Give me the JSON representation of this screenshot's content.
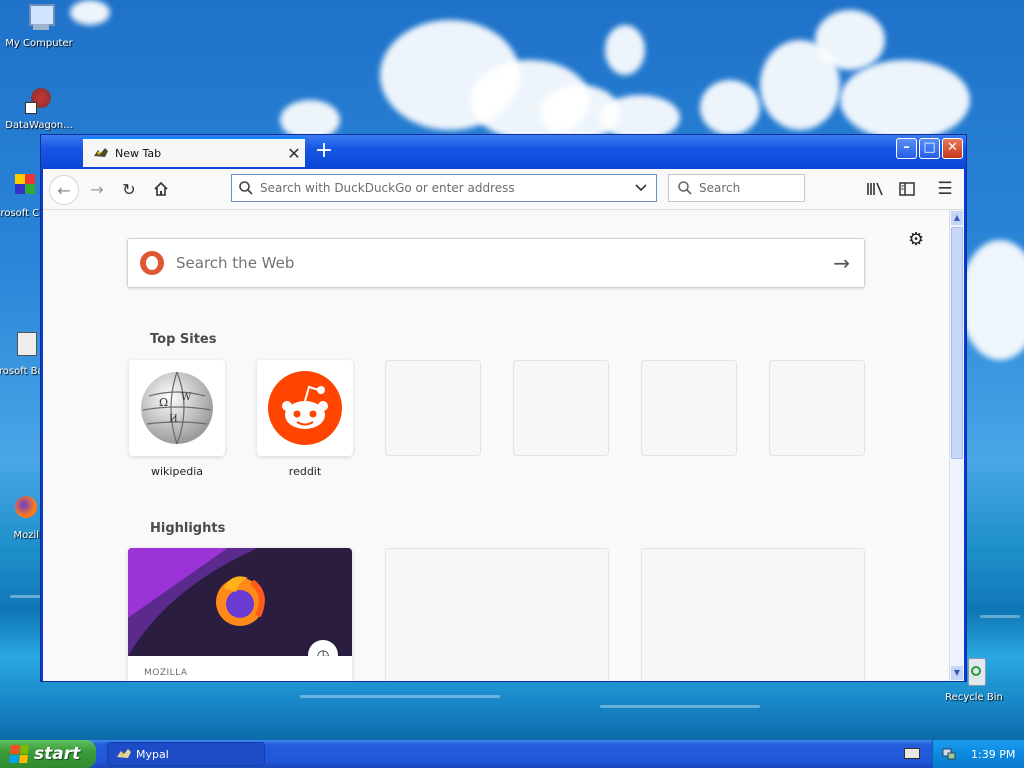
{
  "desktop": {
    "icons": [
      {
        "label": "My Computer"
      },
      {
        "label": "DataWagon..."
      },
      {
        "label": "Microsoft C++"
      },
      {
        "label": "Microsoft Basic"
      },
      {
        "label": "Mozilla"
      },
      {
        "label": "Recycle Bin"
      }
    ]
  },
  "browser": {
    "tab_title": "New Tab",
    "new_tab_glyph": "+",
    "window_buttons": {
      "minimize": "–",
      "maximize": "□",
      "close": "✕"
    },
    "toolbar": {
      "address_placeholder": "Search with DuckDuckGo or enter address",
      "search_placeholder": "Search"
    },
    "newtab": {
      "web_search_placeholder": "Search the Web",
      "top_sites_heading": "Top Sites",
      "top_sites": [
        {
          "label": "wikipedia",
          "icon": "wikipedia-globe-icon"
        },
        {
          "label": "reddit",
          "icon": "reddit-alien-icon"
        },
        {
          "label": ""
        },
        {
          "label": ""
        },
        {
          "label": ""
        },
        {
          "label": ""
        }
      ],
      "highlights_heading": "Highlights",
      "highlights": [
        {
          "source": "MOZILLA",
          "image": "firefox-logo"
        },
        {
          "source": ""
        },
        {
          "source": ""
        }
      ]
    }
  },
  "taskbar": {
    "start_label": "start",
    "task_label": "Mypal",
    "clock": "1:39 PM"
  },
  "colors": {
    "accent": "#0a84ff",
    "reddit": "#ff4500",
    "xp_blue": "#245edb",
    "start_green": "#3c9d3c"
  }
}
